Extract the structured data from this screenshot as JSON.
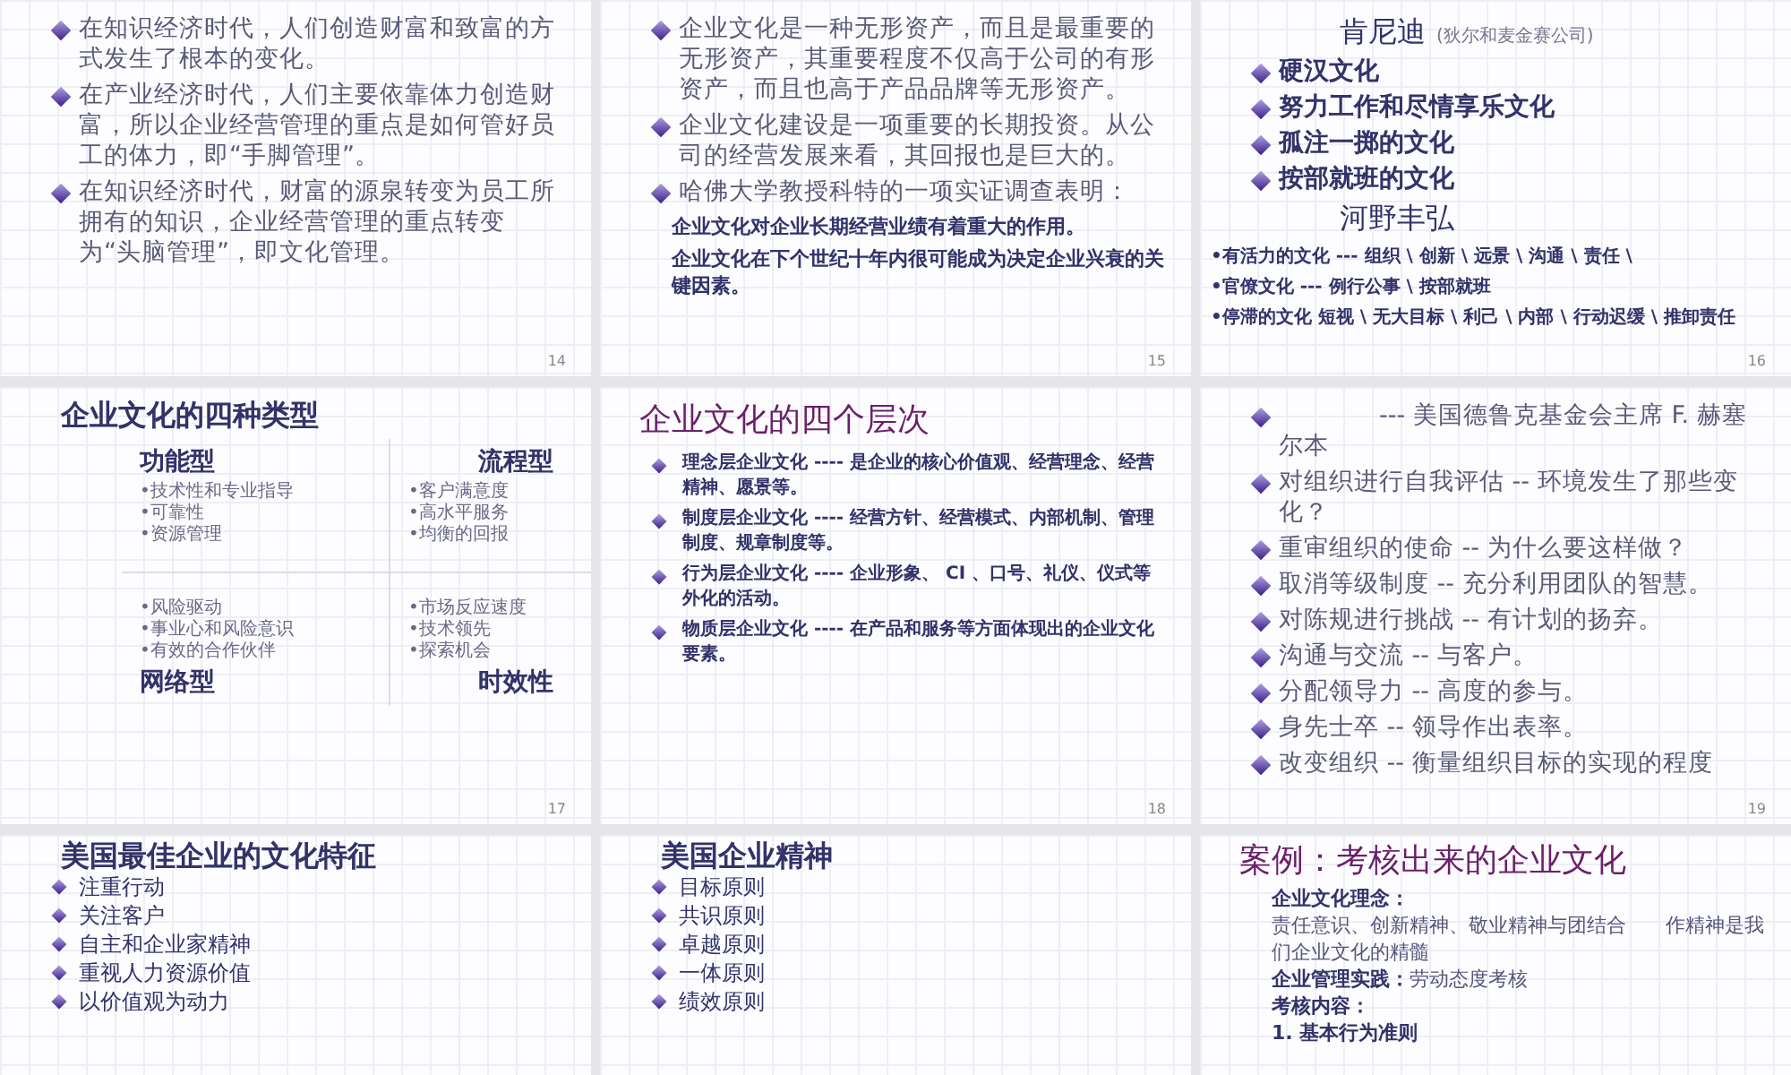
{
  "slides": [
    {
      "number": "14",
      "kind": "list",
      "lines": [
        {
          "kind": "bullet",
          "text": "在知识经济时代，人们创造财富和致富的方式发生了根本的变化。"
        },
        {
          "kind": "bullet",
          "text": "在产业经济时代，人们主要依靠体力创造财富，所以企业经营管理的重点是如何管好员工的体力，即“手脚管理”。"
        },
        {
          "kind": "bullet",
          "text": "在知识经济时代，财富的源泉转变为员工所拥有的知识，企业经营管理的重点转变为“头脑管理”，即文化管理。"
        }
      ]
    },
    {
      "number": "15",
      "kind": "list",
      "lines": [
        {
          "kind": "bullet",
          "text": "企业文化是一种无形资产，而且是最重要的无形资产，其重要程度不仅高于公司的有形资产，而且也高于产品品牌等无形资产。"
        },
        {
          "kind": "bullet",
          "text": "企业文化建设是一项重要的长期投资。从公司的经营发展来看，其回报也是巨大的。"
        },
        {
          "kind": "bullet",
          "text": "哈佛大学教授科特的一项实证调查表明："
        },
        {
          "kind": "bold",
          "text": "企业文化对企业长期经营业绩有着重大的作用。"
        },
        {
          "kind": "bold",
          "text": "企业文化在下个世纪十年内很可能成为决定企业兴衰的关键因素。"
        }
      ]
    },
    {
      "number": "16",
      "kind": "list",
      "lines": [
        {
          "kind": "heading",
          "text": "肯尼迪",
          "aside": "(狄尔和麦金赛公司)"
        },
        {
          "kind": "strong-bullet",
          "text": "硬汉文化"
        },
        {
          "kind": "strong-bullet",
          "text": "努力工作和尽情享乐文化"
        },
        {
          "kind": "strong-bullet",
          "text": "孤注一掷的文化"
        },
        {
          "kind": "strong-bullet",
          "text": "按部就班的文化"
        },
        {
          "kind": "heading",
          "text": "河野丰弘"
        },
        {
          "kind": "small",
          "text": "•有活力的文化 --- 组织 \\ 创新 \\ 远景 \\ 沟通 \\ 责任 \\"
        },
        {
          "kind": "small",
          "text": "•官僚文化 ---  例行公事 \\ 按部就班"
        },
        {
          "kind": "small",
          "text": "•停滞的文化 短视 \\ 无大目标 \\ 利己 \\ 内部 \\ 行动迟缓 \\ 推卸责任"
        }
      ]
    },
    {
      "number": "17",
      "kind": "quadrant",
      "title": {
        "text": "企业文化的四种类型",
        "bold": true
      },
      "quadrants": [
        {
          "title": "功能型",
          "label_below": false,
          "items": [
            "•技术性和专业指导",
            "•可靠性",
            "•资源管理"
          ]
        },
        {
          "title": "流程型",
          "label_below": false,
          "items": [
            "•客户满意度",
            "•高水平服务",
            "•均衡的回报"
          ]
        },
        {
          "title": "网络型",
          "label_below": true,
          "items": [
            "•风险驱动",
            "•事业心和风险意识",
            "•有效的合作伙伴"
          ]
        },
        {
          "title": "时效性",
          "label_below": true,
          "items": [
            "•市场反应速度",
            "•技术领先",
            "•探索机会"
          ]
        }
      ]
    },
    {
      "number": "18",
      "kind": "list",
      "title": {
        "text": "企业文化的四个层次",
        "bold": false
      },
      "lines": [
        {
          "kind": "compact-bullet",
          "text": "理念层企业文化 ---- 是企业的核心价值观、经营理念、经营精神、愿景等。"
        },
        {
          "kind": "compact-bullet",
          "text": "制度层企业文化 ---- 经营方针、经营模式、内部机制、管理制度、规章制度等。"
        },
        {
          "kind": "compact-bullet",
          "text": "行为层企业文化 ---- 企业形象、 CI 、口号、礼仪、仪式等外化的活动。"
        },
        {
          "kind": "compact-bullet",
          "text": "物质层企业文化 ---- 在产品和服务等方面体现出的企业文化要素。"
        }
      ]
    },
    {
      "number": "19",
      "kind": "list",
      "lines": [
        {
          "kind": "bullet",
          "text": "　　　　--- 美国德鲁克基金会主席  F. 赫塞尔本"
        },
        {
          "kind": "bullet",
          "text": "对组织进行自我评估 -- 环境发生了那些变化？"
        },
        {
          "kind": "bullet",
          "text": "重审组织的使命 -- 为什么要这样做？"
        },
        {
          "kind": "bullet",
          "text": "取消等级制度 -- 充分利用团队的智慧。"
        },
        {
          "kind": "bullet",
          "text": "对陈规进行挑战 -- 有计划的扬弃。"
        },
        {
          "kind": "bullet",
          "text": "沟通与交流 -- 与客户。"
        },
        {
          "kind": "bullet",
          "text": "分配领导力 -- 高度的参与。"
        },
        {
          "kind": "bullet",
          "text": "身先士卒 -- 领导作出表率。"
        },
        {
          "kind": "bullet",
          "text": "改变组织 -- 衡量组织目标的实现的程度"
        }
      ]
    },
    {
      "kind": "list",
      "title": {
        "text": "美国最佳企业的文化特征",
        "bold": true
      },
      "lines": [
        {
          "kind": "dot-bullet",
          "text": "注重行动"
        },
        {
          "kind": "dot-bullet",
          "text": "关注客户"
        },
        {
          "kind": "dot-bullet",
          "text": "自主和企业家精神"
        },
        {
          "kind": "dot-bullet",
          "text": "重视人力资源价值"
        },
        {
          "kind": "dot-bullet",
          "text": "以价值观为动力"
        }
      ]
    },
    {
      "kind": "list",
      "title": {
        "text": "美国企业精神",
        "bold": true
      },
      "lines": [
        {
          "kind": "dot-bullet",
          "text": "目标原则"
        },
        {
          "kind": "dot-bullet",
          "text": "共识原则"
        },
        {
          "kind": "dot-bullet",
          "text": "卓越原则"
        },
        {
          "kind": "dot-bullet",
          "text": "一体原则"
        },
        {
          "kind": "dot-bullet",
          "text": "绩效原则"
        }
      ]
    },
    {
      "kind": "list",
      "title": {
        "text": "案例：考核出来的企业文化",
        "bold": false
      },
      "lines": [
        {
          "kind": "bold",
          "text": "企业文化理念："
        },
        {
          "kind": "plain",
          "text": "责任意识、创新精神、敬业精神与团结合　　作精神是我们企业文化的精髓"
        },
        {
          "kind": "mixed",
          "text": "**企业管理实践：**劳动态度考核"
        },
        {
          "kind": "bold",
          "text": "考核内容："
        },
        {
          "kind": "bold",
          "text": "1. 基本行为准则"
        }
      ]
    }
  ]
}
